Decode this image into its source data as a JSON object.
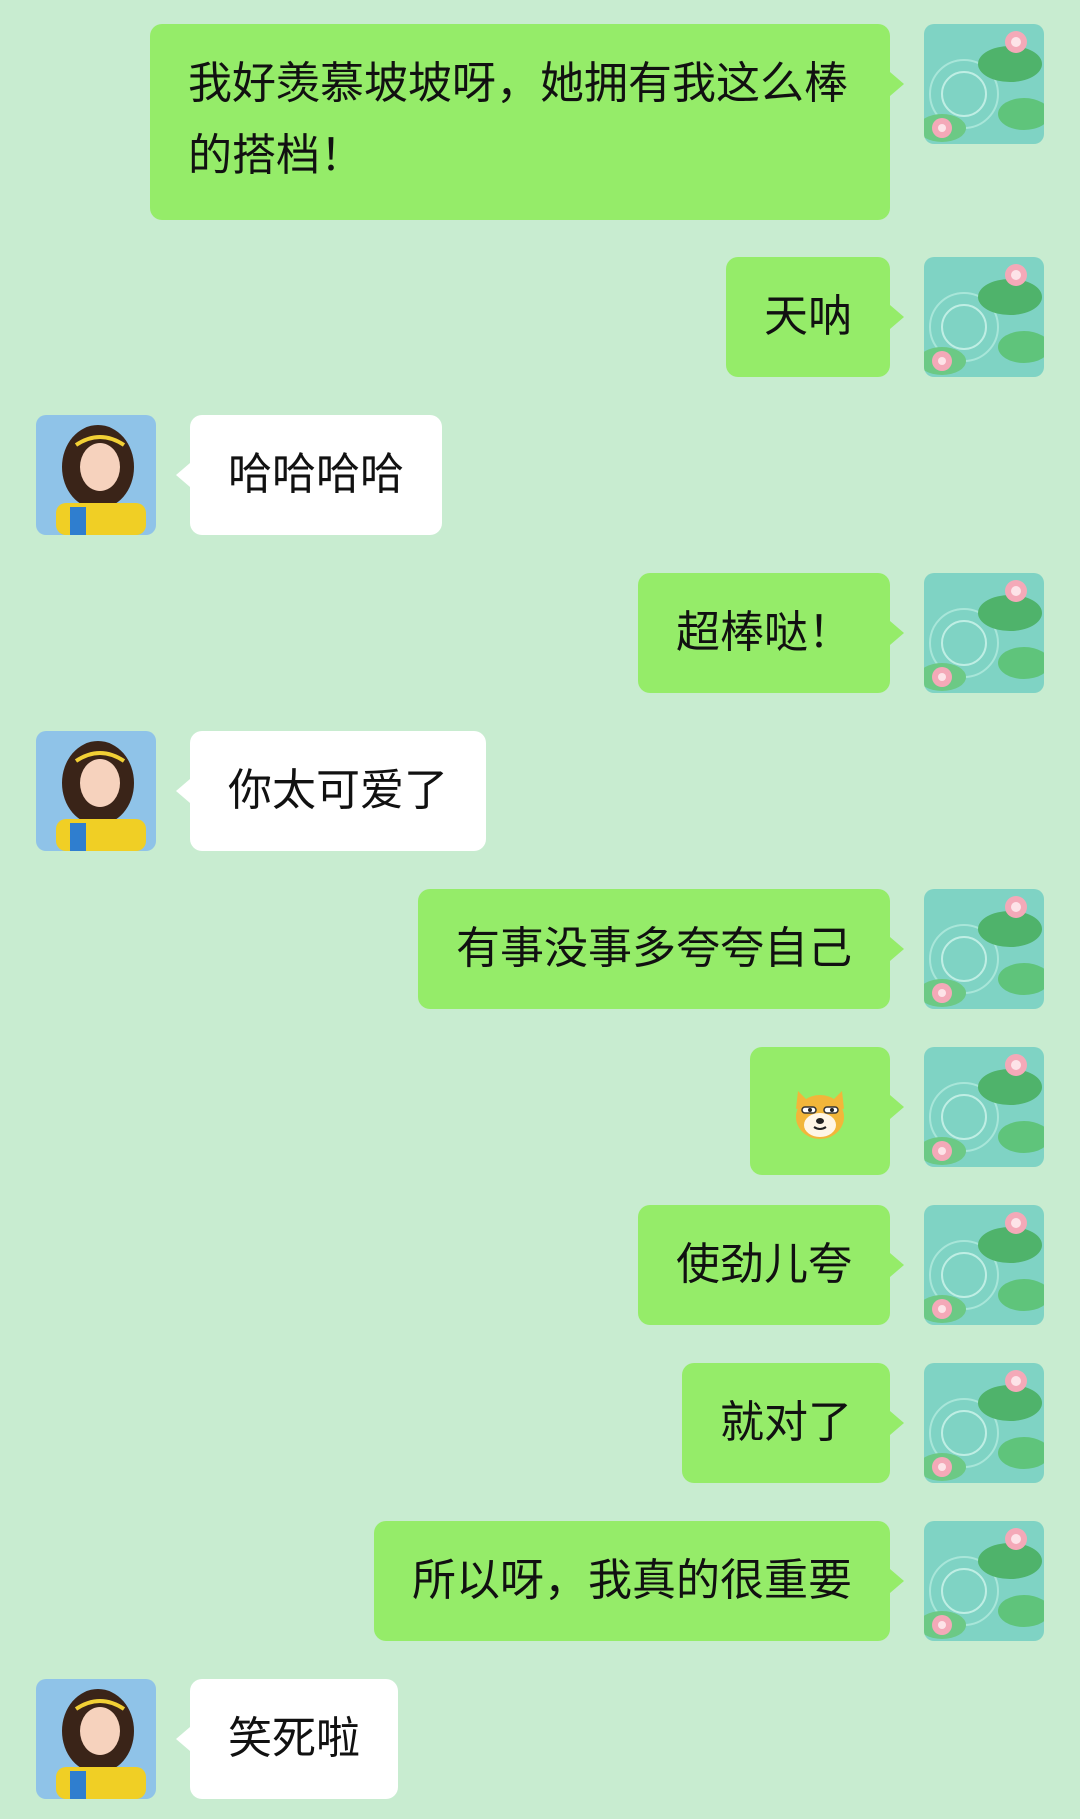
{
  "conversation": {
    "messages": [
      {
        "sender": "me",
        "text": "我好羡慕坡坡呀，她拥有我这么棒的搭档！"
      },
      {
        "sender": "me",
        "text": "天呐"
      },
      {
        "sender": "other",
        "text": "哈哈哈哈"
      },
      {
        "sender": "me",
        "text": "超棒哒！"
      },
      {
        "sender": "other",
        "text": "你太可爱了"
      },
      {
        "sender": "me",
        "text": "有事没事多夸夸自己"
      },
      {
        "sender": "me",
        "emoji": "doge-emoji-icon"
      },
      {
        "sender": "me",
        "text": "使劲儿夸"
      },
      {
        "sender": "me",
        "text": "就对了"
      },
      {
        "sender": "me",
        "text": "所以呀，我真的很重要"
      },
      {
        "sender": "other",
        "text": "笑死啦"
      }
    ]
  },
  "avatars": {
    "me": "lotus-pond-avatar",
    "other": "girl-yellow-shirt-avatar"
  },
  "colors": {
    "background": "#c8ecd0",
    "my_bubble": "#95ec69",
    "other_bubble": "#ffffff"
  }
}
